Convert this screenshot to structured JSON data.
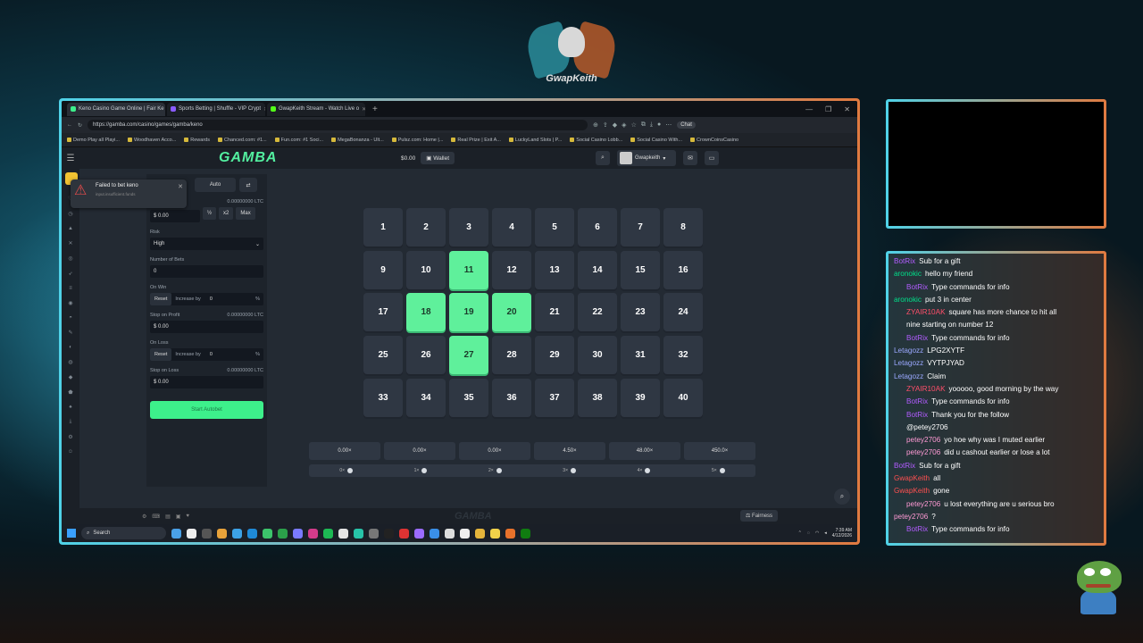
{
  "streamer": {
    "logo_name": "GwapKeith"
  },
  "browser": {
    "tabs": [
      {
        "title": "Keno Casino Game Online | Fair Ke",
        "color": "#3df08b",
        "active": true
      },
      {
        "title": "Sports Betting | Shuffle - VIP Crypt",
        "color": "#8a5cff",
        "active": false
      },
      {
        "title": "GwapKeith Stream - Watch Live o",
        "color": "#53fc18",
        "active": false
      }
    ],
    "url": "https://gamba.com/casino/games/gamba/keno",
    "chat_label": "Chat",
    "bookmarks": [
      "Demo Play all Playi...",
      "Woodhaven Acco...",
      "Rewards",
      "Chanced.com: #1...",
      "Fun.com: #1 Soci...",
      "MegaBonanza - Ult...",
      "Pulsz.com: Home |...",
      "Real Prize | Exit A...",
      "LuckyLand Slots | P...",
      "Social Casino Lobb...",
      "Social Casino With...",
      "CrownCoinsCasino"
    ]
  },
  "site": {
    "brand": "GAMBA",
    "balance": "$0.00",
    "wallet_label": "Wallet",
    "username": "Gwapkeith",
    "toast": {
      "title": "Failed to bet keno",
      "detail": "input.insufficient.funds"
    },
    "panel": {
      "mode_auto": "Auto",
      "bet_amount_ltc": "0.00000000 LTC",
      "bet_amount": "$ 0.00",
      "half": "½",
      "double": "x2",
      "max": "Max",
      "risk_label": "Risk",
      "risk_value": "High",
      "num_bets_label": "Number of Bets",
      "num_bets_value": "0",
      "on_win_label": "On Win",
      "reset_label": "Reset",
      "increase_label": "Increase by",
      "on_win_value": "0",
      "pct": "%",
      "stop_profit_label": "Stop on Profit",
      "stop_profit_ltc": "0.00000000 LTC",
      "stop_profit_value": "$ 0.00",
      "on_loss_label": "On Loss",
      "on_loss_value": "0",
      "stop_loss_label": "Stop on Loss",
      "stop_loss_ltc": "0.00000000 LTC",
      "stop_loss_value": "$ 0.00",
      "start_label": "Start Autobet"
    },
    "tiles": [
      "1",
      "2",
      "3",
      "4",
      "5",
      "6",
      "7",
      "8",
      "9",
      "10",
      "11",
      "12",
      "13",
      "14",
      "15",
      "16",
      "17",
      "18",
      "19",
      "20",
      "21",
      "22",
      "23",
      "24",
      "25",
      "26",
      "27",
      "28",
      "29",
      "30",
      "31",
      "32",
      "33",
      "34",
      "35",
      "36",
      "37",
      "38",
      "39",
      "40"
    ],
    "selected_tiles": [
      11,
      18,
      19,
      20,
      27
    ],
    "payouts": [
      "0.00×",
      "0.00×",
      "0.00×",
      "4.50×",
      "48.00×",
      "450.0×"
    ],
    "hits": [
      "0×",
      "1×",
      "2×",
      "3×",
      "4×",
      "5×"
    ],
    "fairness_label": "Fairness",
    "footer_logo": "GAMBA"
  },
  "taskbar": {
    "search_label": "Search",
    "time": "7:39 AM",
    "date": "4/12/2026"
  },
  "chat": [
    {
      "user": "BotRix",
      "color": "#b25cff",
      "text": "Sub for a gift",
      "indent": false
    },
    {
      "user": "aronokic",
      "color": "#00e08a",
      "text": "hello my friend",
      "indent": false
    },
    {
      "user": "BotRix",
      "color": "#b25cff",
      "text": "Type commands for info",
      "indent": true
    },
    {
      "user": "aronokic",
      "color": "#00e08a",
      "text": "put 3 in center",
      "indent": false
    },
    {
      "user": "ZYAIR10AK",
      "color": "#ff4f6a",
      "text": "square has more chance to hit all",
      "indent": true
    },
    {
      "user": "",
      "color": "#ffffff",
      "text": "nine starting on number 12",
      "indent": true
    },
    {
      "user": "BotRix",
      "color": "#b25cff",
      "text": "Type commands for info",
      "indent": true
    },
    {
      "user": "Letagozz",
      "color": "#9aa8ff",
      "text": "LPG2XYTF",
      "indent": false
    },
    {
      "user": "Letagozz",
      "color": "#9aa8ff",
      "text": "VYTPJYAD",
      "indent": false
    },
    {
      "user": "Letagozz",
      "color": "#9aa8ff",
      "text": "Claim",
      "indent": false
    },
    {
      "user": "ZYAIR10AK",
      "color": "#ff4f6a",
      "text": "yooooo, good morning by the way",
      "indent": true
    },
    {
      "user": "BotRix",
      "color": "#b25cff",
      "text": "Type commands for info",
      "indent": true
    },
    {
      "user": "BotRix",
      "color": "#b25cff",
      "text": "Thank you for the follow",
      "indent": true
    },
    {
      "user": "",
      "color": "#ffffff",
      "text": "@petey2706",
      "indent": true
    },
    {
      "user": "petey2706",
      "color": "#ff9ad5",
      "text": "yo hoe why was I muted earlier",
      "indent": true
    },
    {
      "user": "petey2706",
      "color": "#ff9ad5",
      "text": "did u cashout earlier or lose a lot",
      "indent": true
    },
    {
      "user": "BotRix",
      "color": "#b25cff",
      "text": "Sub for a gift",
      "indent": false
    },
    {
      "user": "GwapKeith",
      "color": "#ff5050",
      "text": "all",
      "indent": false
    },
    {
      "user": "GwapKeith",
      "color": "#ff5050",
      "text": "gone",
      "indent": false
    },
    {
      "user": "petey2706",
      "color": "#ff9ad5",
      "text": "u lost everything are u serious bro",
      "indent": true
    },
    {
      "user": "petey2706",
      "color": "#ff9ad5",
      "text": "?",
      "indent": false
    },
    {
      "user": "BotRix",
      "color": "#b25cff",
      "text": "Type commands for info",
      "indent": true
    }
  ]
}
